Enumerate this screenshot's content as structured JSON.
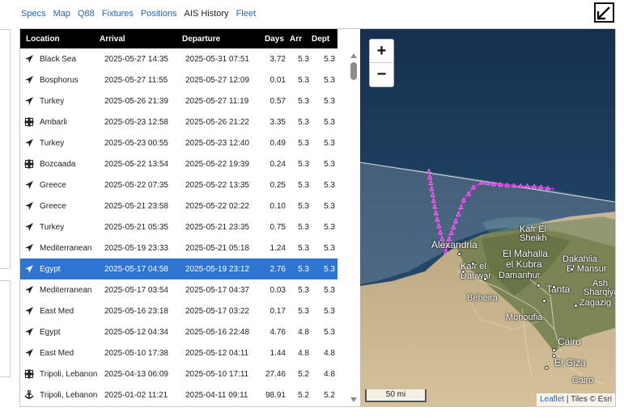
{
  "tabs": [
    {
      "label": "Specs",
      "active": false
    },
    {
      "label": "Map",
      "active": false
    },
    {
      "label": "Q88",
      "active": false
    },
    {
      "label": "Fixtures",
      "active": false
    },
    {
      "label": "Positions",
      "active": false
    },
    {
      "label": "AIS History",
      "active": true
    },
    {
      "label": "Fleet",
      "active": false
    }
  ],
  "table": {
    "headers": [
      "Location",
      "Arrival",
      "Departure",
      "Days",
      "Arr",
      "Dept"
    ],
    "rows": [
      {
        "icon": "arrow-icon",
        "location": "Black Sea",
        "arrival": "2025-05-27 14:35",
        "departure": "2025-05-31 07:51",
        "days": "3.72",
        "arr": "5.3",
        "dept": "5.3",
        "selected": false
      },
      {
        "icon": "arrow-icon",
        "location": "Bosphorus",
        "arrival": "2025-05-27 11:55",
        "departure": "2025-05-27 12:09",
        "days": "0.01",
        "arr": "5.3",
        "dept": "5.3",
        "selected": false
      },
      {
        "icon": "arrow-icon",
        "location": "Turkey",
        "arrival": "2025-05-26 21:39",
        "departure": "2025-05-27 11:19",
        "days": "0.57",
        "arr": "5.3",
        "dept": "5.3",
        "selected": false
      },
      {
        "icon": "port-icon",
        "location": "Ambarli",
        "arrival": "2025-05-23 12:58",
        "departure": "2025-05-26 21:22",
        "days": "3.35",
        "arr": "5.3",
        "dept": "5.3",
        "selected": false
      },
      {
        "icon": "arrow-icon",
        "location": "Turkey",
        "arrival": "2025-05-23 00:55",
        "departure": "2025-05-23 12:40",
        "days": "0.49",
        "arr": "5.3",
        "dept": "5.3",
        "selected": false
      },
      {
        "icon": "port-icon",
        "location": "Bozcaada",
        "arrival": "2025-05-22 13:54",
        "departure": "2025-05-22 19:39",
        "days": "0.24",
        "arr": "5.3",
        "dept": "5.3",
        "selected": false
      },
      {
        "icon": "arrow-icon",
        "location": "Greece",
        "arrival": "2025-05-22 07:35",
        "departure": "2025-05-22 13:35",
        "days": "0.25",
        "arr": "5.3",
        "dept": "5.3",
        "selected": false
      },
      {
        "icon": "arrow-icon",
        "location": "Greece",
        "arrival": "2025-05-21 23:58",
        "departure": "2025-05-22 02:22",
        "days": "0.10",
        "arr": "5.3",
        "dept": "5.3",
        "selected": false
      },
      {
        "icon": "arrow-icon",
        "location": "Turkey",
        "arrival": "2025-05-21 05:35",
        "departure": "2025-05-21 23:35",
        "days": "0.75",
        "arr": "5.3",
        "dept": "5.3",
        "selected": false
      },
      {
        "icon": "arrow-icon",
        "location": "Mediterranean",
        "arrival": "2025-05-19 23:33",
        "departure": "2025-05-21 05:18",
        "days": "1.24",
        "arr": "5.3",
        "dept": "5.3",
        "selected": false
      },
      {
        "icon": "arrow-icon",
        "location": "Egypt",
        "arrival": "2025-05-17 04:58",
        "departure": "2025-05-19 23:12",
        "days": "2.76",
        "arr": "5.3",
        "dept": "5.3",
        "selected": true
      },
      {
        "icon": "arrow-icon",
        "location": "Mediterranean",
        "arrival": "2025-05-17 03:54",
        "departure": "2025-05-17 04:37",
        "days": "0.03",
        "arr": "5.3",
        "dept": "5.3",
        "selected": false
      },
      {
        "icon": "arrow-icon",
        "location": "East Med",
        "arrival": "2025-05-16 23:18",
        "departure": "2025-05-17 03:22",
        "days": "0.17",
        "arr": "5.3",
        "dept": "5.3",
        "selected": false
      },
      {
        "icon": "arrow-icon",
        "location": "Egypt",
        "arrival": "2025-05-12 04:34",
        "departure": "2025-05-16 22:48",
        "days": "4.76",
        "arr": "4.8",
        "dept": "5.3",
        "selected": false
      },
      {
        "icon": "arrow-icon",
        "location": "East Med",
        "arrival": "2025-05-10 17:38",
        "departure": "2025-05-12 04:11",
        "days": "1.44",
        "arr": "4.8",
        "dept": "4.8",
        "selected": false
      },
      {
        "icon": "port-icon",
        "location": "Tripoli, Lebanon",
        "arrival": "2025-04-13 06:09",
        "departure": "2025-05-10 17:11",
        "days": "27.46",
        "arr": "5.2",
        "dept": "4.8",
        "selected": false
      },
      {
        "icon": "anchor-icon",
        "location": "Tripoli, Lebanon",
        "arrival": "2025-01-02 11:21",
        "departure": "2025-04-11 09:11",
        "days": "98.91",
        "arr": "5.2",
        "dept": "5.2",
        "selected": false
      }
    ]
  },
  "map": {
    "zoom_in_label": "+",
    "zoom_out_label": "−",
    "scale_label": "50 mi",
    "attribution_link": "Leaflet",
    "attribution_text": "| Tiles © Esri",
    "track_color": "#e020e0",
    "places": [
      {
        "name": "Alexandria",
        "big": true
      },
      {
        "name": "Kafr El",
        "big": false
      },
      {
        "name": "Sheikh",
        "big": false
      },
      {
        "name": "El Mahalla",
        "big": true
      },
      {
        "name": "el Kubra",
        "big": true
      },
      {
        "name": "Dakahlia",
        "big": false
      },
      {
        "name": "El Mansur",
        "big": false
      },
      {
        "name": "Kafr el",
        "big": false
      },
      {
        "name": "Dauwar",
        "big": false
      },
      {
        "name": "Damanhur",
        "big": false
      },
      {
        "name": "Tanta",
        "big": true
      },
      {
        "name": "Ash",
        "big": false
      },
      {
        "name": "Sharqiya",
        "big": false
      },
      {
        "name": "Beheira",
        "big": false
      },
      {
        "name": "Zagazig",
        "big": false
      },
      {
        "name": "Monoufia",
        "big": false
      },
      {
        "name": "Cairo",
        "big": true
      },
      {
        "name": "El Giza",
        "big": true
      },
      {
        "name": "Cairo",
        "big": false
      }
    ]
  }
}
